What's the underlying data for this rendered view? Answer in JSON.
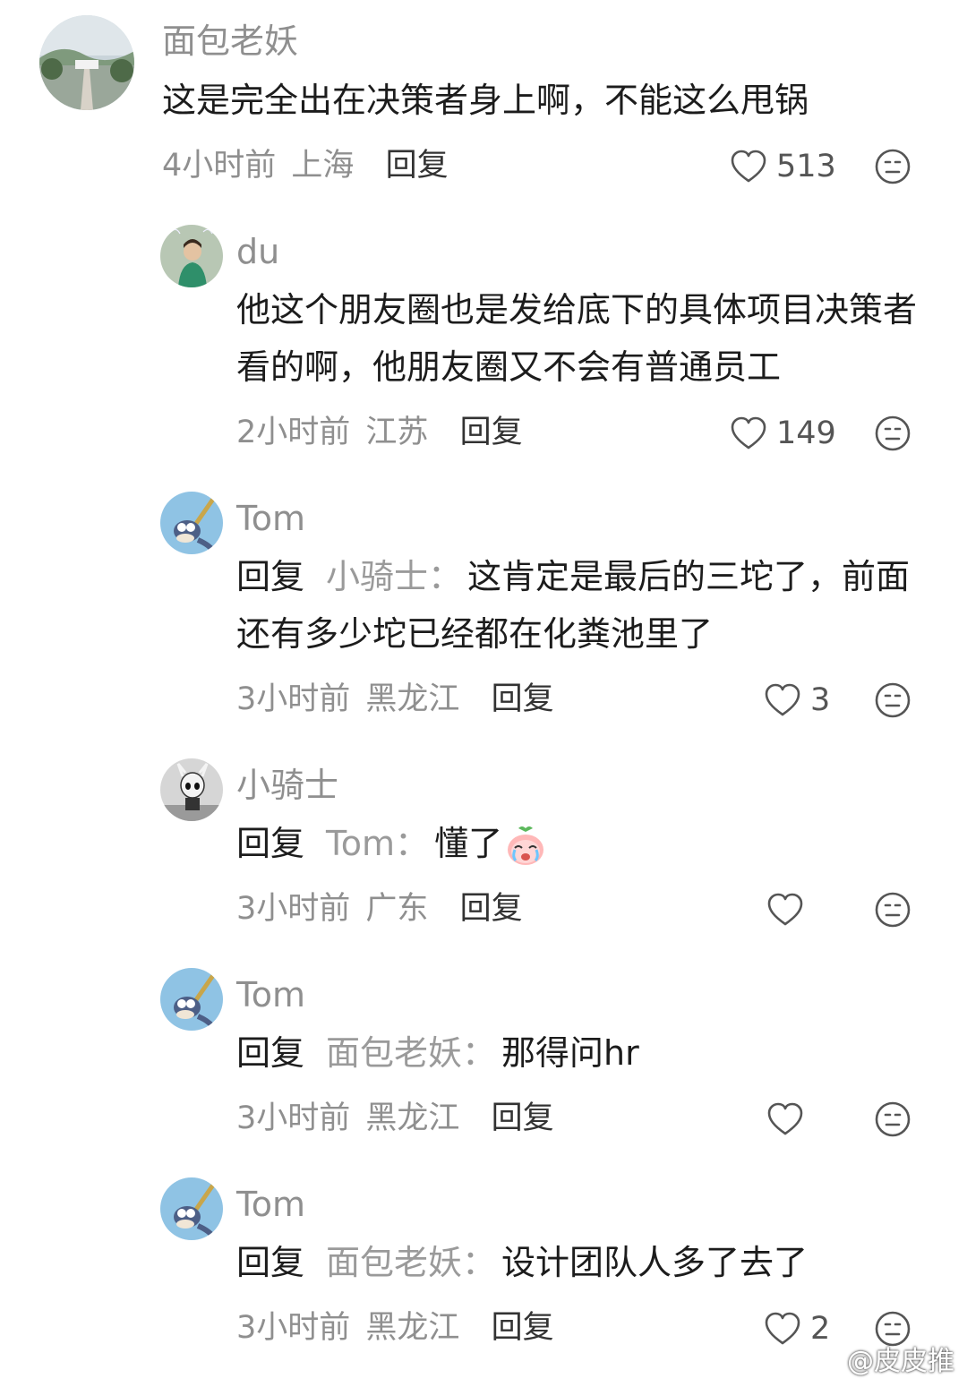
{
  "comments": [
    {
      "name": "面包老妖",
      "text": "这是完全出在决策者身上啊，不能这么甩锅",
      "time": "4小时前",
      "location": "上海",
      "reply_label": "回复",
      "likes": "513"
    },
    {
      "name": "du",
      "text": "他这个朋友圈也是发给底下的具体项目决策者看的啊，他朋友圈又不会有普通员工",
      "time": "2小时前",
      "location": "江苏",
      "reply_label": "回复",
      "likes": "149"
    },
    {
      "name": "Tom",
      "reply_prefix": "回复",
      "reply_to": "小骑士",
      "colon": "：",
      "text": "这肯定是最后的三坨了，前面还有多少坨已经都在化粪池里了",
      "time": "3小时前",
      "location": "黑龙江",
      "reply_label": "回复",
      "likes": "3"
    },
    {
      "name": "小骑士",
      "reply_prefix": "回复",
      "reply_to": "Tom",
      "colon": "：",
      "text": "懂了",
      "time": "3小时前",
      "location": "广东",
      "reply_label": "回复",
      "likes": ""
    },
    {
      "name": "Tom",
      "reply_prefix": "回复",
      "reply_to": "面包老妖",
      "colon": "：",
      "text": "那得问hr",
      "time": "3小时前",
      "location": "黑龙江",
      "reply_label": "回复",
      "likes": ""
    },
    {
      "name": "Tom",
      "reply_prefix": "回复",
      "reply_to": "面包老妖",
      "colon": "：",
      "text": "设计团队人多了去了",
      "time": "3小时前",
      "location": "黑龙江",
      "reply_label": "回复",
      "likes": "2"
    }
  ],
  "icons": {
    "like": "heart-outline-icon",
    "dislike": "meh-face-icon",
    "emoji": "crying-peach-emoji"
  },
  "watermark": "@皮皮推"
}
